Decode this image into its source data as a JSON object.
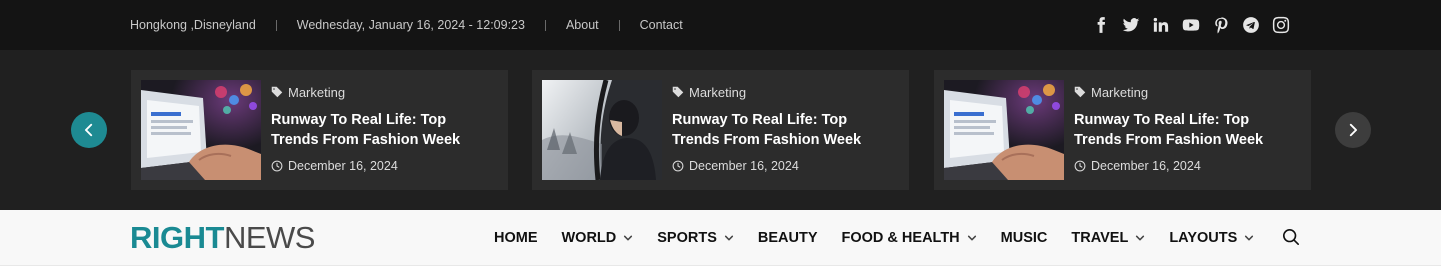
{
  "topbar": {
    "location": "Hongkong ,Disneyland",
    "datetime": "Wednesday, January 16, 2024 - 12:09:23",
    "about": "About",
    "contact": "Contact",
    "social_icons": [
      "facebook-icon",
      "twitter-icon",
      "linkedin-icon",
      "youtube-icon",
      "pinterest-icon",
      "telegram-icon",
      "instagram-icon"
    ]
  },
  "slider": {
    "cards": [
      {
        "category": "Marketing",
        "title": "Runway To Real Life: Top Trends From Fashion Week",
        "date": "December 16, 2024",
        "image": "laptop-photo"
      },
      {
        "category": "Marketing",
        "title": "Runway To Real Life: Top Trends From Fashion Week",
        "date": "December 16, 2024",
        "image": "window-portrait-photo"
      },
      {
        "category": "Marketing",
        "title": "Runway To Real Life: Top Trends From Fashion Week",
        "date": "December 16, 2024",
        "image": "laptop-photo"
      }
    ]
  },
  "header": {
    "logo_bold": "RIGHT",
    "logo_light": "NEWS",
    "nav": [
      {
        "label": "HOME",
        "dropdown": false
      },
      {
        "label": "WORLD",
        "dropdown": true
      },
      {
        "label": "SPORTS",
        "dropdown": true
      },
      {
        "label": "BEAUTY",
        "dropdown": false
      },
      {
        "label": "FOOD & HEALTH",
        "dropdown": true
      },
      {
        "label": "MUSIC",
        "dropdown": false
      },
      {
        "label": "TRAVEL",
        "dropdown": true
      },
      {
        "label": "LAYOUTS",
        "dropdown": true
      }
    ]
  },
  "colors": {
    "topbar_bg": "#141414",
    "slider_bg": "#202020",
    "card_bg": "#2c2c2c",
    "accent": "#1a8a93",
    "header_bg": "#f8f8f8"
  }
}
